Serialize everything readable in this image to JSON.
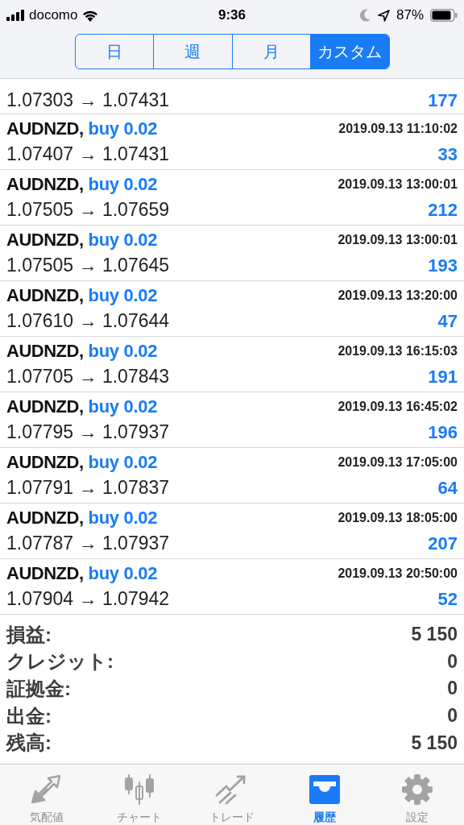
{
  "status_bar": {
    "carrier": "docomo",
    "time": "9:36",
    "battery": "87%"
  },
  "period_tabs": [
    {
      "label": "日",
      "selected": false
    },
    {
      "label": "週",
      "selected": false
    },
    {
      "label": "月",
      "selected": false
    },
    {
      "label": "カスタム",
      "selected": true
    }
  ],
  "deals": [
    {
      "prices": "1.07303 → 1.07431",
      "profit": "177"
    },
    {
      "symbol": "AUDNZD,",
      "side": "buy 0.02",
      "time": "2019.09.13 11:10:02",
      "prices": "1.07407 → 1.07431",
      "profit": "33"
    },
    {
      "symbol": "AUDNZD,",
      "side": "buy 0.02",
      "time": "2019.09.13 13:00:01",
      "prices": "1.07505 → 1.07659",
      "profit": "212"
    },
    {
      "symbol": "AUDNZD,",
      "side": "buy 0.02",
      "time": "2019.09.13 13:00:01",
      "prices": "1.07505 → 1.07645",
      "profit": "193"
    },
    {
      "symbol": "AUDNZD,",
      "side": "buy 0.02",
      "time": "2019.09.13 13:20:00",
      "prices": "1.07610 → 1.07644",
      "profit": "47"
    },
    {
      "symbol": "AUDNZD,",
      "side": "buy 0.02",
      "time": "2019.09.13 16:15:03",
      "prices": "1.07705 → 1.07843",
      "profit": "191"
    },
    {
      "symbol": "AUDNZD,",
      "side": "buy 0.02",
      "time": "2019.09.13 16:45:02",
      "prices": "1.07795 → 1.07937",
      "profit": "196"
    },
    {
      "symbol": "AUDNZD,",
      "side": "buy 0.02",
      "time": "2019.09.13 17:05:00",
      "prices": "1.07791 → 1.07837",
      "profit": "64"
    },
    {
      "symbol": "AUDNZD,",
      "side": "buy 0.02",
      "time": "2019.09.13 18:05:00",
      "prices": "1.07787 → 1.07937",
      "profit": "207"
    },
    {
      "symbol": "AUDNZD,",
      "side": "buy 0.02",
      "time": "2019.09.13 20:50:00",
      "prices": "1.07904 → 1.07942",
      "profit": "52"
    }
  ],
  "summary": [
    {
      "label": "損益:",
      "value": "5 150"
    },
    {
      "label": "クレジット:",
      "value": "0"
    },
    {
      "label": "証拠金:",
      "value": "0"
    },
    {
      "label": "出金:",
      "value": "0"
    },
    {
      "label": "残高:",
      "value": "5 150"
    }
  ],
  "tab_bar": [
    {
      "label": "気配値",
      "selected": false
    },
    {
      "label": "チャート",
      "selected": false
    },
    {
      "label": "トレード",
      "selected": false
    },
    {
      "label": "履歴",
      "selected": true
    },
    {
      "label": "設定",
      "selected": false
    }
  ]
}
